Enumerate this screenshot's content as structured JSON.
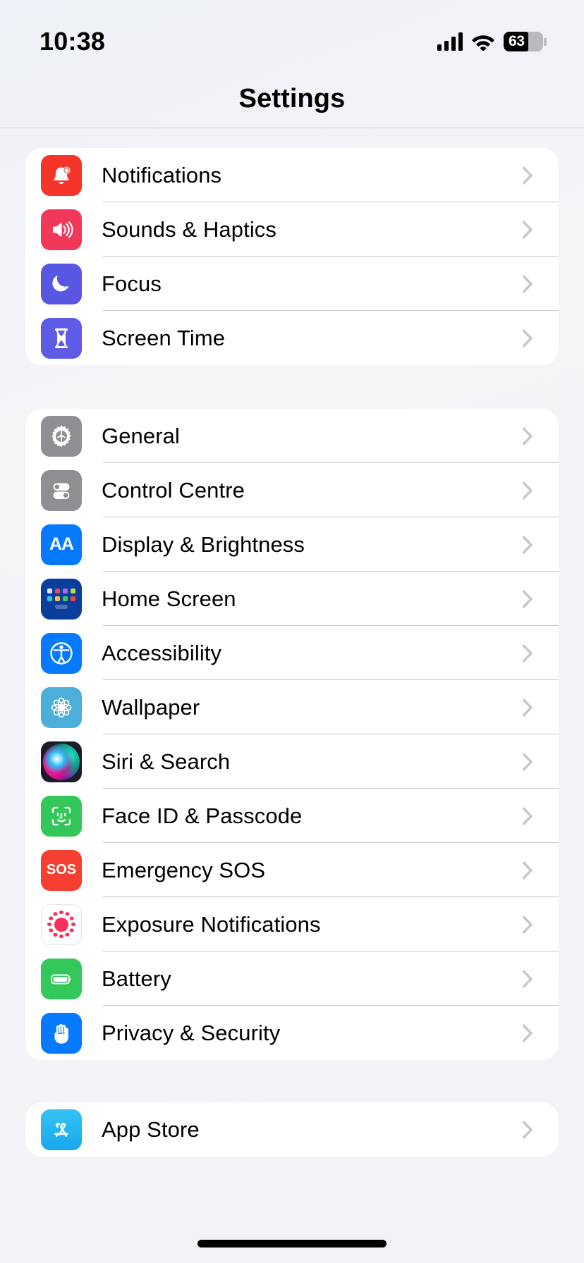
{
  "status_bar": {
    "time": "10:38",
    "cellular_icon": "cellular-bars-icon",
    "wifi_icon": "wifi-icon",
    "battery_percent": "63",
    "battery_level": 63
  },
  "nav": {
    "title": "Settings"
  },
  "colors": {
    "page_background": "#f2f2f7",
    "card_background": "#ffffff",
    "separator": "#c9c9cd",
    "chevron": "#c4c4c8",
    "label_text": "#000000"
  },
  "groups": [
    {
      "id": "group-alerts",
      "rows": [
        {
          "label": "Notifications",
          "icon": "bell-icon",
          "icon_class": "ic-notifications",
          "chevron": true
        },
        {
          "label": "Sounds & Haptics",
          "icon": "speaker-wave-icon",
          "icon_class": "ic-sounds",
          "chevron": true
        },
        {
          "label": "Focus",
          "icon": "moon-icon",
          "icon_class": "ic-focus",
          "chevron": true
        },
        {
          "label": "Screen Time",
          "icon": "hourglass-icon",
          "icon_class": "ic-screentime",
          "chevron": true
        }
      ]
    },
    {
      "id": "group-system",
      "rows": [
        {
          "label": "General",
          "icon": "gear-icon",
          "icon_class": "ic-general",
          "chevron": true
        },
        {
          "label": "Control Centre",
          "icon": "toggles-icon",
          "icon_class": "ic-control",
          "chevron": true
        },
        {
          "label": "Display & Brightness",
          "icon": "aa-text-size-icon",
          "icon_class": "ic-display",
          "chevron": true
        },
        {
          "label": "Home Screen",
          "icon": "app-grid-icon",
          "icon_class": "ic-home",
          "chevron": true
        },
        {
          "label": "Accessibility",
          "icon": "accessibility-icon",
          "icon_class": "ic-access",
          "chevron": true
        },
        {
          "label": "Wallpaper",
          "icon": "flower-icon",
          "icon_class": "ic-wallpaper",
          "chevron": true
        },
        {
          "label": "Siri & Search",
          "icon": "siri-orb-icon",
          "icon_class": "ic-siri",
          "chevron": true
        },
        {
          "label": "Face ID & Passcode",
          "icon": "face-id-icon",
          "icon_class": "ic-faceid",
          "chevron": true
        },
        {
          "label": "Emergency SOS",
          "icon": "sos-icon",
          "icon_class": "ic-sos",
          "chevron": true
        },
        {
          "label": "Exposure Notifications",
          "icon": "exposure-dots-icon",
          "icon_class": "ic-exposure",
          "chevron": true
        },
        {
          "label": "Battery",
          "icon": "battery-icon",
          "icon_class": "ic-battery",
          "chevron": true
        },
        {
          "label": "Privacy & Security",
          "icon": "hand-raised-icon",
          "icon_class": "ic-privacy",
          "chevron": true
        }
      ]
    },
    {
      "id": "group-services",
      "partially_visible": true,
      "rows": [
        {
          "label": "App Store",
          "icon": "app-store-icon",
          "icon_class": "ic-appstore",
          "chevron": true
        }
      ]
    }
  ],
  "home_indicator": {
    "visible": true
  }
}
